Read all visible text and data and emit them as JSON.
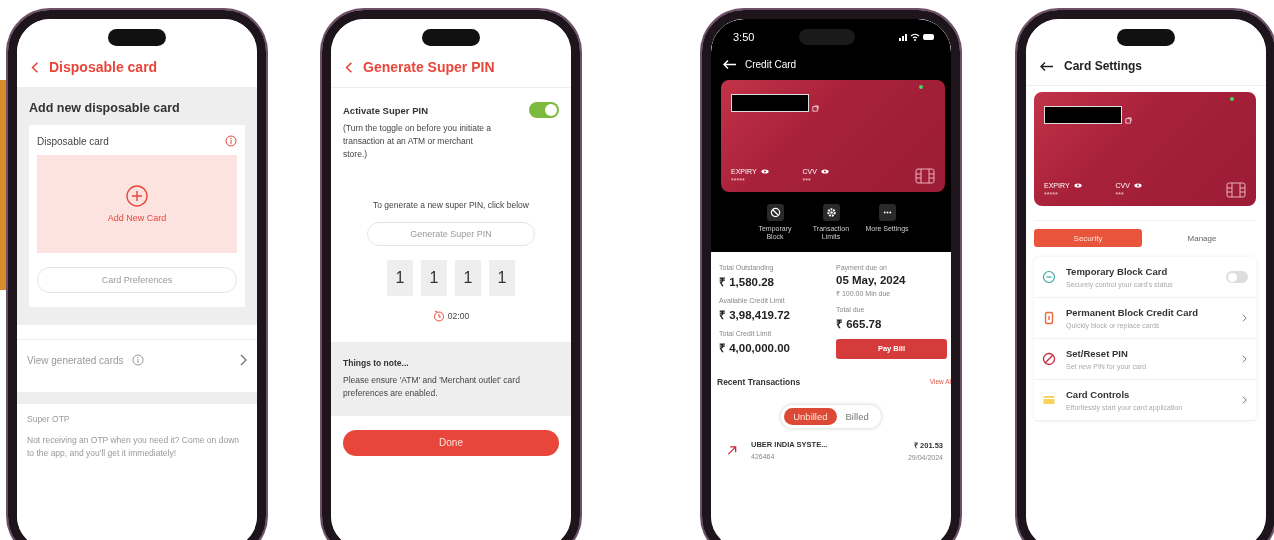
{
  "disposable_card_screen": {
    "title": "Disposable card",
    "heading": "Add new disposable card",
    "card_label": "Disposable card",
    "add_label": "Add New Card",
    "preferences_button": {
      "label": "Card Preferences",
      "disabled": true
    },
    "generated_link": "View generated cards",
    "otp_title": "Super OTP",
    "otp_text": "Not receiving an OTP when you need it? Come on down to the app, and you'll get it immediately!"
  },
  "super_pin_screen": {
    "title": "Generate Super PIN",
    "toggle": {
      "label": "Activate Super PIN",
      "on": true
    },
    "toggle_note": "(Turn the toggle on before you initiate a transaction at an ATM or merchant store.)",
    "prompt": "To generate a new super PIN, click below",
    "generate_button": {
      "label": "Generate Super PIN",
      "disabled": true
    },
    "pin_digits": [
      "1",
      "1",
      "1",
      "1"
    ],
    "timer": "02:00",
    "notes_title": "Things to note...",
    "notes_text": "Please ensure 'ATM' and 'Merchant outlet' card preferences are enabled.",
    "done_button": "Done"
  },
  "credit_card_screen": {
    "status_time": "3:50",
    "title": "Credit Card",
    "card": {
      "expiry_label": "EXPIRY",
      "expiry_value": "*****",
      "cvv_label": "CVV",
      "cvv_value": "***"
    },
    "actions": [
      {
        "label": "Temporary Block"
      },
      {
        "label": "Transaction Limits"
      },
      {
        "label": "More Settings"
      }
    ],
    "summary_left": [
      {
        "label": "Total Outstanding",
        "value": "₹ 1,580.28"
      },
      {
        "label": "Available Credit Limit",
        "value": "₹ 3,98,419.72"
      },
      {
        "label": "Total Credit Limit",
        "value": "₹ 4,00,000.00"
      }
    ],
    "payment_due_label": "Payment due on",
    "payment_due_date": "05 May, 2024",
    "min_due": "₹ 100.00 Min due",
    "total_due_label": "Total due",
    "total_due_value": "₹ 665.78",
    "pay_button": "Pay Bill",
    "recent_title": "Recent Transactions",
    "view_all": "View Al",
    "segments": [
      {
        "label": "Unbilled",
        "selected": true
      },
      {
        "label": "Billed",
        "selected": false
      }
    ],
    "transactions": [
      {
        "name": "UBER INDIA SYSTE...",
        "reference": "426464",
        "amount": "₹ 201.53",
        "date": "29/04/2024"
      }
    ]
  },
  "card_settings_screen": {
    "title": "Card Settings",
    "card": {
      "expiry_label": "EXPIRY",
      "expiry_value": "*****",
      "cvv_label": "CVV",
      "cvv_value": "***"
    },
    "tabs": [
      {
        "label": "Security",
        "selected": true
      },
      {
        "label": "Manage",
        "selected": false
      }
    ],
    "options": [
      {
        "kind": "toggle",
        "title": "Temporary Block Card",
        "subtitle": "Securely control your card's status",
        "on": false
      },
      {
        "kind": "link",
        "title": "Permanent Block Credit Card",
        "subtitle": "Quickly block or replace cards"
      },
      {
        "kind": "link",
        "title": "Set/Reset PIN",
        "subtitle": "Set new PIN for your card"
      },
      {
        "kind": "link",
        "title": "Card Controls",
        "subtitle": "Effortlessly start your card application"
      }
    ]
  }
}
